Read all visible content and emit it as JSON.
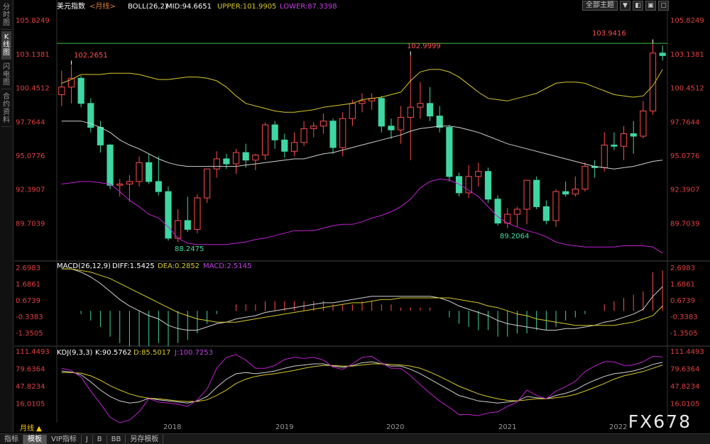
{
  "sidebar": {
    "tabs": [
      {
        "label": "分时图",
        "active": false
      },
      {
        "label": "K线图",
        "active": true
      },
      {
        "label": "闪电图",
        "active": false
      },
      {
        "label": "合约资料",
        "active": false
      }
    ]
  },
  "header": {
    "instrument": "美元指数",
    "period": "<月线>",
    "boll": "BOLL(26,2)",
    "mid": "MID:94.6651",
    "upper": "UPPER:101.9905",
    "lower": "LOWER:87.3398",
    "theme_button": "全部主题",
    "window_buttons": [
      "▼",
      "◧",
      "▣",
      "▢"
    ]
  },
  "main_axis_ticks": [
    "105.8249",
    "103.1381",
    "100.4512",
    "97.7644",
    "95.0776",
    "92.3907",
    "89.7039"
  ],
  "annotations": {
    "high1": "102.2651",
    "high2": "102.9999",
    "high3": "103.9416",
    "low1": "88.2475",
    "low2": "89.2064"
  },
  "macd": {
    "label": "MACD(26,12,9)",
    "diff": "DIFF:1.5425",
    "dea": "DEA:0.2852",
    "macd": "MACD:2.5145",
    "ticks": [
      "2.6983",
      "1.6861",
      "0.6739",
      "-0.3383",
      "-1.3505"
    ]
  },
  "kdj": {
    "label": "KDJ(9,3,3)",
    "k": "K:90.5762",
    "d": "D:85.5017",
    "j": "J:100.7253",
    "ticks": [
      "111.4493",
      "79.6364",
      "47.8234",
      "16.0105"
    ]
  },
  "time_axis": {
    "period_label": "月线 ▲",
    "years": [
      "2018",
      "2019",
      "2020",
      "2021",
      "2022"
    ]
  },
  "bottom_tabs": [
    {
      "label": "指标",
      "active": false
    },
    {
      "label": "模板",
      "active": true
    },
    {
      "label": "VIP指标",
      "active": false
    },
    {
      "label": "J",
      "active": false
    },
    {
      "label": "B",
      "active": false
    },
    {
      "label": "BB",
      "active": false
    },
    {
      "label": "另存模板",
      "active": false
    }
  ],
  "watermark": "FX678",
  "colors": {
    "up": "#ff4d4d",
    "down": "#3fd6a4",
    "mid": "#d0d0d0",
    "upper": "#d8c92a",
    "lower": "#c020d0",
    "dea": "#d8c92a",
    "diff": "#d0d0d0",
    "j": "#c020d0"
  },
  "chart_data": {
    "type": "candlestick",
    "x": [
      "2017-03",
      "2017-04",
      "2017-05",
      "2017-06",
      "2017-07",
      "2017-08",
      "2017-09",
      "2017-10",
      "2017-11",
      "2017-12",
      "2018-01",
      "2018-02",
      "2018-03",
      "2018-04",
      "2018-05",
      "2018-06",
      "2018-07",
      "2018-08",
      "2018-09",
      "2018-10",
      "2018-11",
      "2018-12",
      "2019-01",
      "2019-02",
      "2019-03",
      "2019-04",
      "2019-05",
      "2019-06",
      "2019-07",
      "2019-08",
      "2019-09",
      "2019-10",
      "2019-11",
      "2019-12",
      "2020-01",
      "2020-02",
      "2020-03",
      "2020-04",
      "2020-05",
      "2020-06",
      "2020-07",
      "2020-08",
      "2020-09",
      "2020-10",
      "2020-11",
      "2020-12",
      "2021-01",
      "2021-02",
      "2021-03",
      "2021-04",
      "2021-05",
      "2021-06",
      "2021-07",
      "2021-08",
      "2021-09",
      "2021-10",
      "2021-11",
      "2021-12",
      "2022-01",
      "2022-02",
      "2022-03",
      "2022-04",
      "2022-05"
    ],
    "ohlc": [
      [
        99.9,
        101.8,
        99.0,
        100.5
      ],
      [
        100.5,
        102.2,
        99.2,
        101.2
      ],
      [
        101.2,
        101.4,
        98.9,
        99.2
      ],
      [
        99.2,
        99.6,
        96.9,
        97.3
      ],
      [
        97.3,
        97.8,
        95.3,
        95.9
      ],
      [
        95.9,
        96.0,
        92.4,
        92.7
      ],
      [
        92.7,
        93.2,
        91.8,
        92.8
      ],
      [
        92.8,
        93.5,
        91.4,
        93.0
      ],
      [
        93.0,
        95.0,
        92.6,
        94.5
      ],
      [
        94.5,
        95.2,
        92.8,
        93.0
      ],
      [
        93.0,
        95.0,
        91.9,
        92.2
      ],
      [
        92.2,
        92.6,
        88.3,
        88.5
      ],
      [
        88.5,
        90.8,
        88.2,
        89.9
      ],
      [
        89.9,
        91.8,
        89.0,
        89.2
      ],
      [
        89.2,
        92.0,
        88.9,
        91.7
      ],
      [
        91.7,
        94.0,
        91.3,
        94.0
      ],
      [
        94.0,
        95.4,
        93.3,
        94.8
      ],
      [
        94.8,
        95.2,
        94.0,
        94.4
      ],
      [
        94.4,
        95.6,
        93.6,
        95.3
      ],
      [
        95.3,
        96.0,
        94.1,
        94.7
      ],
      [
        94.7,
        95.2,
        93.9,
        95.1
      ],
      [
        95.1,
        97.7,
        94.7,
        97.5
      ],
      [
        97.5,
        97.8,
        95.6,
        96.3
      ],
      [
        96.3,
        96.8,
        94.9,
        95.4
      ],
      [
        95.4,
        96.9,
        95.0,
        96.1
      ],
      [
        96.1,
        97.8,
        95.8,
        97.2
      ],
      [
        97.2,
        97.7,
        96.5,
        97.4
      ],
      [
        97.4,
        98.4,
        96.8,
        97.8
      ],
      [
        97.8,
        98.0,
        95.2,
        95.7
      ],
      [
        95.7,
        98.5,
        95.0,
        98.0
      ],
      [
        98.0,
        99.5,
        97.4,
        99.2
      ],
      [
        99.2,
        100.0,
        98.5,
        99.4
      ],
      [
        99.4,
        100.0,
        98.7,
        99.6
      ],
      [
        99.6,
        99.8,
        96.9,
        97.4
      ],
      [
        97.4,
        98.0,
        96.4,
        97.1
      ],
      [
        97.1,
        99.0,
        96.0,
        98.1
      ],
      [
        98.1,
        103.0,
        94.7,
        98.9
      ],
      [
        98.9,
        100.9,
        98.0,
        99.2
      ],
      [
        99.2,
        100.5,
        97.8,
        98.2
      ],
      [
        98.2,
        99.0,
        96.9,
        97.3
      ],
      [
        97.3,
        97.5,
        93.0,
        93.4
      ],
      [
        93.4,
        93.7,
        91.8,
        92.1
      ],
      [
        92.1,
        94.3,
        91.7,
        93.4
      ],
      [
        93.4,
        94.5,
        92.6,
        93.8
      ],
      [
        93.8,
        94.1,
        91.3,
        91.6
      ],
      [
        91.6,
        91.9,
        89.5,
        89.7
      ],
      [
        89.7,
        90.9,
        89.3,
        90.4
      ],
      [
        90.4,
        91.0,
        89.4,
        90.8
      ],
      [
        90.8,
        93.1,
        89.6,
        93.1
      ],
      [
        93.1,
        93.4,
        90.8,
        91.0
      ],
      [
        91.0,
        91.5,
        89.6,
        89.9
      ],
      [
        89.9,
        92.4,
        89.4,
        92.2
      ],
      [
        92.2,
        93.0,
        91.8,
        92.0
      ],
      [
        92.0,
        93.4,
        91.8,
        92.4
      ],
      [
        92.4,
        94.5,
        92.2,
        94.2
      ],
      [
        94.2,
        94.7,
        93.3,
        94.1
      ],
      [
        94.1,
        96.9,
        93.8,
        95.9
      ],
      [
        95.9,
        96.9,
        95.5,
        95.8
      ],
      [
        95.8,
        97.4,
        94.7,
        96.8
      ],
      [
        96.8,
        97.8,
        95.2,
        96.6
      ],
      [
        96.6,
        99.4,
        96.4,
        98.6
      ],
      [
        98.6,
        103.9,
        98.3,
        103.2
      ],
      [
        103.2,
        103.8,
        102.6,
        103.0
      ]
    ],
    "boll_mid": [
      97.8,
      97.8,
      97.8,
      97.6,
      97.3,
      96.9,
      96.3,
      95.9,
      95.6,
      95.2,
      94.8,
      94.5,
      94.3,
      94.2,
      94.2,
      94.2,
      94.2,
      94.2,
      94.2,
      94.3,
      94.4,
      94.5,
      94.6,
      94.7,
      94.8,
      94.8,
      95.0,
      95.2,
      95.3,
      95.5,
      95.7,
      95.9,
      96.1,
      96.3,
      96.5,
      96.7,
      97.0,
      97.2,
      97.3,
      97.4,
      97.4,
      97.3,
      97.1,
      96.9,
      96.6,
      96.3,
      96.0,
      95.8,
      95.6,
      95.4,
      95.2,
      95.0,
      94.8,
      94.6,
      94.4,
      94.2,
      94.1,
      94.0,
      94.1,
      94.2,
      94.4,
      94.6,
      94.7
    ],
    "boll_upper": [
      100.8,
      101.1,
      101.5,
      101.5,
      101.5,
      101.6,
      101.6,
      101.6,
      101.5,
      101.3,
      101.1,
      101.1,
      101.2,
      101.3,
      101.3,
      101.2,
      101.0,
      100.5,
      99.8,
      99.2,
      99.0,
      98.8,
      98.6,
      98.5,
      98.5,
      98.6,
      98.7,
      98.9,
      99.0,
      99.1,
      99.2,
      99.5,
      99.6,
      99.7,
      99.9,
      100.1,
      101.0,
      101.7,
      101.9,
      101.9,
      101.7,
      101.3,
      100.7,
      100.1,
      99.6,
      99.5,
      99.4,
      99.6,
      99.8,
      100.0,
      100.4,
      100.8,
      100.9,
      100.9,
      100.8,
      100.5,
      100.2,
      99.9,
      99.8,
      99.7,
      99.8,
      100.6,
      101.9
    ],
    "boll_lower": [
      92.8,
      92.9,
      93.0,
      93.0,
      92.9,
      92.8,
      92.2,
      91.5,
      91.0,
      90.4,
      90.1,
      89.4,
      88.5,
      88.1,
      88.0,
      88.0,
      88.0,
      88.0,
      88.1,
      88.2,
      88.4,
      88.5,
      88.7,
      88.9,
      89.1,
      89.1,
      89.1,
      89.3,
      89.5,
      89.6,
      89.6,
      89.8,
      90.1,
      90.3,
      90.6,
      91.0,
      91.6,
      92.5,
      93.0,
      93.2,
      93.1,
      92.8,
      92.3,
      91.8,
      91.0,
      90.2,
      89.7,
      89.4,
      89.1,
      88.9,
      88.6,
      88.2,
      88.0,
      87.9,
      87.8,
      87.8,
      87.8,
      87.8,
      87.9,
      87.9,
      87.9,
      87.8,
      87.3
    ],
    "macd_diff": [
      2.6,
      2.6,
      2.4,
      2.1,
      1.7,
      1.2,
      0.7,
      0.3,
      0.0,
      -0.3,
      -0.5,
      -0.9,
      -1.1,
      -1.2,
      -1.2,
      -1.0,
      -0.8,
      -0.7,
      -0.5,
      -0.4,
      -0.3,
      -0.1,
      0.0,
      0.1,
      0.2,
      0.3,
      0.4,
      0.5,
      0.5,
      0.6,
      0.7,
      0.8,
      0.9,
      0.9,
      0.9,
      0.9,
      0.9,
      0.9,
      0.9,
      0.8,
      0.6,
      0.3,
      0.1,
      -0.1,
      -0.3,
      -0.6,
      -0.8,
      -0.9,
      -1.0,
      -1.1,
      -1.2,
      -1.2,
      -1.1,
      -1.1,
      -1.0,
      -0.9,
      -0.7,
      -0.6,
      -0.4,
      -0.2,
      0.1,
      0.9,
      1.5
    ],
    "macd_dea": [
      2.6,
      2.6,
      2.5,
      2.4,
      2.2,
      2.0,
      1.7,
      1.4,
      1.1,
      0.8,
      0.5,
      0.2,
      -0.1,
      -0.3,
      -0.5,
      -0.6,
      -0.7,
      -0.7,
      -0.7,
      -0.6,
      -0.5,
      -0.4,
      -0.3,
      -0.2,
      -0.1,
      0.0,
      0.1,
      0.2,
      0.3,
      0.4,
      0.5,
      0.5,
      0.6,
      0.7,
      0.7,
      0.8,
      0.8,
      0.8,
      0.8,
      0.8,
      0.8,
      0.7,
      0.6,
      0.5,
      0.3,
      0.2,
      0.0,
      -0.2,
      -0.3,
      -0.5,
      -0.6,
      -0.7,
      -0.8,
      -0.9,
      -0.9,
      -0.9,
      -0.9,
      -0.9,
      -0.8,
      -0.7,
      -0.5,
      -0.3,
      0.3
    ],
    "macd_hist": [
      0.0,
      0.0,
      -0.2,
      -0.6,
      -1.0,
      -1.6,
      -2.0,
      -2.2,
      -2.2,
      -2.2,
      -2.0,
      -2.2,
      -2.0,
      -1.8,
      -1.4,
      -0.8,
      -0.2,
      0.0,
      0.4,
      0.4,
      0.4,
      0.6,
      0.6,
      0.6,
      0.6,
      0.6,
      0.6,
      0.6,
      0.4,
      0.4,
      0.4,
      0.6,
      0.6,
      0.4,
      0.4,
      0.2,
      0.2,
      0.2,
      0.2,
      0.0,
      -0.4,
      -0.8,
      -1.0,
      -1.2,
      -1.2,
      -1.6,
      -1.6,
      -1.4,
      -1.4,
      -1.2,
      -1.2,
      -1.0,
      -0.6,
      -0.4,
      -0.2,
      0.0,
      0.4,
      0.6,
      0.8,
      1.0,
      1.2,
      2.4,
      2.5
    ],
    "kdj_k": [
      75,
      73,
      68,
      55,
      40,
      28,
      20,
      16,
      18,
      25,
      22,
      20,
      18,
      16,
      20,
      28,
      45,
      60,
      70,
      72,
      70,
      72,
      75,
      80,
      84,
      86,
      88,
      88,
      84,
      82,
      85,
      90,
      92,
      88,
      84,
      84,
      78,
      70,
      60,
      50,
      40,
      30,
      25,
      20,
      18,
      16,
      18,
      20,
      28,
      26,
      24,
      30,
      34,
      40,
      50,
      58,
      65,
      70,
      72,
      75,
      80,
      87,
      91
    ],
    "kdj_d": [
      72,
      72,
      71,
      66,
      58,
      48,
      40,
      33,
      28,
      25,
      24,
      22,
      20,
      19,
      19,
      22,
      30,
      40,
      52,
      60,
      65,
      68,
      70,
      73,
      76,
      80,
      83,
      85,
      85,
      84,
      84,
      86,
      88,
      88,
      87,
      86,
      84,
      80,
      73,
      65,
      56,
      47,
      40,
      33,
      28,
      24,
      21,
      20,
      22,
      24,
      24,
      26,
      28,
      32,
      38,
      45,
      52,
      60,
      66,
      70,
      74,
      80,
      86
    ],
    "kdj_j": [
      80,
      76,
      64,
      38,
      15,
      -10,
      -20,
      -15,
      0,
      24,
      18,
      16,
      14,
      10,
      22,
      42,
      80,
      100,
      105,
      95,
      80,
      80,
      85,
      96,
      100,
      98,
      100,
      95,
      82,
      78,
      88,
      100,
      102,
      90,
      80,
      80,
      66,
      50,
      34,
      20,
      8,
      -5,
      -5,
      -7,
      -2,
      0,
      10,
      18,
      40,
      30,
      24,
      38,
      46,
      56,
      74,
      84,
      92,
      92,
      85,
      86,
      92,
      102,
      101
    ]
  }
}
